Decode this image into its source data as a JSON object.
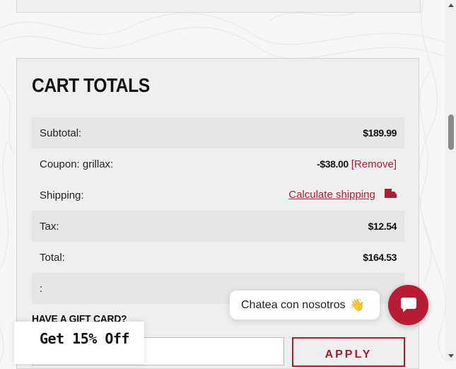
{
  "cart": {
    "title": "CART TOTALS",
    "rows": [
      {
        "label": "Subtotal:",
        "value": "$189.99"
      },
      {
        "label": "Coupon: grillax:",
        "value": "-$38.00",
        "action": "[Remove]"
      },
      {
        "label": "Shipping:",
        "link": "Calculate shipping",
        "icon": "truck-icon"
      },
      {
        "label": "Tax:",
        "value": "$12.54"
      },
      {
        "label": "Total:",
        "value": "$164.53"
      },
      {
        "label": ":"
      }
    ]
  },
  "gift": {
    "heading": "HAVE A GIFT CARD?",
    "input_placeholder": "",
    "apply_label": "APPLY"
  },
  "promo": {
    "label": "Get 15% Off"
  },
  "chat": {
    "bubble_text": "Chatea con nosotros",
    "bubble_emoji": "👋",
    "button_icon": "chat-icon"
  },
  "colors": {
    "accent": "#b01d33",
    "card_bg": "#efefef",
    "row_shade": "#e6e6e6"
  }
}
